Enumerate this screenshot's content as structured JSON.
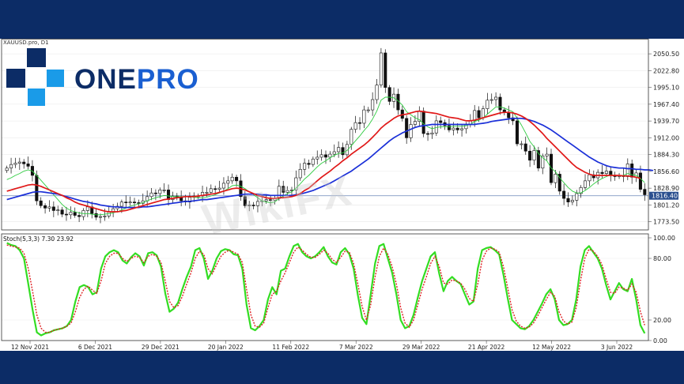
{
  "header": {
    "symbol": "XAUUSD.pro, D1"
  },
  "logo": {
    "prefix": "ONE",
    "suffix": "PRO"
  },
  "watermark": "WikiFX",
  "colors": {
    "background": "#0c2c66",
    "brand_dark": "#0c2c66",
    "brand_blue": "#1a5fd1",
    "ma_red": "#e01818",
    "ma_blue": "#1a2fd8",
    "ma_green": "#2ecc40",
    "stoch_main": "#33dd22",
    "stoch_signal": "#dd2222",
    "current_price_line": "#6c88b8"
  },
  "chart_data": [
    {
      "type": "candlestick",
      "title": "XAUUSD.pro, D1",
      "y_ticks": [
        "2050.50",
        "2022.80",
        "1995.10",
        "1967.40",
        "1939.70",
        "1912.00",
        "1884.30",
        "1856.60",
        "1828.90",
        "1801.20",
        "1773.50"
      ],
      "ylim": [
        1760,
        2065
      ],
      "current_price": 1816.4,
      "current_price_label": "1816.40",
      "x_ticks": [
        "12 Nov 2021",
        "6 Dec 2021",
        "29 Dec 2021",
        "20 Jan 2022",
        "11 Feb 2022",
        "7 Mar 2022",
        "29 Mar 2022",
        "21 Apr 2022",
        "12 May 2022",
        "3 Jun 2022"
      ],
      "close": [
        1862,
        1868,
        1870,
        1872,
        1869,
        1865,
        1850,
        1808,
        1800,
        1796,
        1798,
        1792,
        1793,
        1786,
        1785,
        1789,
        1784,
        1782,
        1792,
        1798,
        1787,
        1781,
        1782,
        1783,
        1790,
        1795,
        1799,
        1806,
        1805,
        1806,
        1805,
        1804,
        1808,
        1815,
        1821,
        1820,
        1826,
        1826,
        1810,
        1816,
        1813,
        1808,
        1806,
        1814,
        1816,
        1816,
        1822,
        1822,
        1828,
        1827,
        1829,
        1837,
        1841,
        1847,
        1841,
        1815,
        1800,
        1801,
        1800,
        1807,
        1808,
        1810,
        1809,
        1812,
        1832,
        1822,
        1825,
        1826,
        1846,
        1860,
        1870,
        1868,
        1877,
        1880,
        1884,
        1880,
        1885,
        1889,
        1896,
        1884,
        1901,
        1926,
        1937,
        1936,
        1958,
        1958,
        1975,
        1999,
        2052,
        1995,
        1972,
        1984,
        1958,
        1944,
        1912,
        1934,
        1939,
        1956,
        1919,
        1918,
        1920,
        1940,
        1937,
        1932,
        1925,
        1928,
        1925,
        1927,
        1934,
        1940,
        1957,
        1945,
        1960,
        1974,
        1975,
        1979,
        1958,
        1954,
        1945,
        1940,
        1902,
        1902,
        1890,
        1875,
        1891,
        1862,
        1882,
        1885,
        1838,
        1852,
        1824,
        1812,
        1806,
        1809,
        1820,
        1830,
        1841,
        1851,
        1846,
        1855,
        1853,
        1857,
        1850,
        1848,
        1850,
        1848,
        1869,
        1847,
        1854,
        1827,
        1818
      ],
      "sma_red": [
        1824,
        1826,
        1828,
        1830,
        1832,
        1834,
        1835,
        1834,
        1832,
        1829,
        1826,
        1823,
        1820,
        1817,
        1813,
        1810,
        1806,
        1803,
        1801,
        1799,
        1797,
        1795,
        1793,
        1791,
        1790,
        1790,
        1790,
        1791,
        1792,
        1794,
        1796,
        1798,
        1800,
        1802,
        1804,
        1806,
        1808,
        1810,
        1811,
        1812,
        1813,
        1814,
        1815,
        1815,
        1815,
        1816,
        1817,
        1818,
        1819,
        1820,
        1822,
        1824,
        1826,
        1828,
        1829,
        1828,
        1826,
        1823,
        1820,
        1817,
        1815,
        1813,
        1812,
        1812,
        1813,
        1813,
        1814,
        1815,
        1817,
        1820,
        1825,
        1829,
        1835,
        1841,
        1847,
        1852,
        1857,
        1863,
        1868,
        1874,
        1879,
        1885,
        1890,
        1895,
        1900,
        1906,
        1913,
        1920,
        1928,
        1934,
        1939,
        1944,
        1948,
        1950,
        1951,
        1953,
        1955,
        1956,
        1955,
        1954,
        1953,
        1952,
        1950,
        1948,
        1946,
        1945,
        1944,
        1942,
        1940,
        1940,
        1941,
        1943,
        1945,
        1947,
        1949,
        1951,
        1953,
        1954,
        1954,
        1953,
        1951,
        1948,
        1944,
        1939,
        1933,
        1926,
        1919,
        1911,
        1904,
        1897,
        1890,
        1883,
        1876,
        1869,
        1863,
        1859,
        1855,
        1852,
        1850,
        1850,
        1850,
        1850,
        1850,
        1850,
        1850,
        1849,
        1849,
        1848,
        1847,
        1845
      ],
      "sma_blue": [
        1810,
        1812,
        1814,
        1816,
        1818,
        1820,
        1822,
        1823,
        1823,
        1822,
        1821,
        1820,
        1819,
        1817,
        1815,
        1813,
        1811,
        1809,
        1807,
        1806,
        1804,
        1803,
        1801,
        1800,
        1799,
        1798,
        1798,
        1797,
        1797,
        1797,
        1797,
        1797,
        1798,
        1798,
        1799,
        1800,
        1801,
        1802,
        1803,
        1804,
        1805,
        1806,
        1807,
        1807,
        1808,
        1809,
        1810,
        1810,
        1811,
        1812,
        1813,
        1814,
        1815,
        1816,
        1817,
        1818,
        1819,
        1819,
        1819,
        1819,
        1818,
        1818,
        1817,
        1817,
        1817,
        1817,
        1817,
        1817,
        1818,
        1819,
        1821,
        1823,
        1825,
        1828,
        1831,
        1834,
        1837,
        1841,
        1845,
        1849,
        1853,
        1857,
        1862,
        1867,
        1872,
        1877,
        1883,
        1889,
        1895,
        1901,
        1907,
        1912,
        1916,
        1920,
        1923,
        1926,
        1929,
        1931,
        1932,
        1933,
        1934,
        1934,
        1934,
        1934,
        1934,
        1934,
        1934,
        1934,
        1934,
        1934,
        1934,
        1935,
        1936,
        1937,
        1939,
        1940,
        1941,
        1942,
        1943,
        1944,
        1944,
        1944,
        1943,
        1941,
        1939,
        1936,
        1933,
        1929,
        1925,
        1920,
        1915,
        1910,
        1905,
        1900,
        1895,
        1890,
        1885,
        1880,
        1876,
        1872,
        1869,
        1866,
        1864,
        1863,
        1862,
        1862,
        1861,
        1861,
        1860,
        1860,
        1859,
        1859,
        1858
      ],
      "sma_green": [
        1843,
        1846,
        1850,
        1853,
        1857,
        1859,
        1857,
        1850,
        1842,
        1834,
        1826,
        1818,
        1810,
        1802,
        1796,
        1792,
        1790,
        1788,
        1787,
        1787,
        1786,
        1785,
        1785,
        1786,
        1787,
        1788,
        1790,
        1793,
        1796,
        1799,
        1801,
        1803,
        1805,
        1808,
        1811,
        1813,
        1815,
        1817,
        1816,
        1815,
        1815,
        1815,
        1815,
        1815,
        1814,
        1813,
        1813,
        1814,
        1816,
        1818,
        1821,
        1824,
        1828,
        1833,
        1834,
        1832,
        1828,
        1823,
        1818,
        1813,
        1808,
        1806,
        1805,
        1806,
        1812,
        1816,
        1820,
        1823,
        1829,
        1836,
        1844,
        1850,
        1857,
        1864,
        1870,
        1874,
        1879,
        1883,
        1886,
        1887,
        1891,
        1899,
        1907,
        1915,
        1924,
        1932,
        1943,
        1956,
        1974,
        1979,
        1979,
        1978,
        1973,
        1966,
        1955,
        1950,
        1945,
        1942,
        1935,
        1930,
        1927,
        1929,
        1930,
        1930,
        1930,
        1931,
        1931,
        1931,
        1932,
        1934,
        1939,
        1941,
        1945,
        1951,
        1957,
        1963,
        1963,
        1961,
        1958,
        1955,
        1944,
        1933,
        1920,
        1906,
        1897,
        1886,
        1879,
        1874,
        1862,
        1856,
        1846,
        1838,
        1830,
        1824,
        1821,
        1821,
        1825,
        1830,
        1836,
        1841,
        1845,
        1848,
        1851,
        1850,
        1850,
        1850,
        1853,
        1851,
        1850,
        1845,
        1838
      ]
    },
    {
      "type": "line",
      "title": "Stoch(5,3,3) 7.30 23.92",
      "y_ticks": [
        "100.00",
        "80.00",
        "20.00",
        "0.00"
      ],
      "ylim": [
        0,
        100
      ],
      "series": [
        {
          "name": "Main",
          "values": [
            95,
            93,
            92,
            88,
            80,
            55,
            30,
            8,
            5,
            7,
            8,
            10,
            11,
            12,
            14,
            20,
            38,
            52,
            54,
            52,
            45,
            47,
            70,
            82,
            86,
            88,
            86,
            78,
            75,
            81,
            85,
            82,
            73,
            85,
            86,
            83,
            72,
            46,
            28,
            31,
            37,
            50,
            62,
            72,
            88,
            90,
            80,
            60,
            68,
            80,
            87,
            89,
            88,
            84,
            83,
            70,
            35,
            12,
            10,
            14,
            20,
            40,
            52,
            45,
            68,
            70,
            82,
            92,
            94,
            86,
            82,
            80,
            82,
            86,
            91,
            82,
            76,
            74,
            86,
            90,
            84,
            70,
            44,
            22,
            16,
            45,
            75,
            92,
            94,
            80,
            66,
            45,
            20,
            12,
            14,
            25,
            42,
            58,
            70,
            82,
            86,
            65,
            48,
            58,
            62,
            58,
            55,
            45,
            35,
            38,
            70,
            88,
            90,
            91,
            88,
            84,
            64,
            41,
            20,
            16,
            12,
            11,
            14,
            20,
            28,
            36,
            45,
            50,
            40,
            20,
            15,
            16,
            20,
            40,
            72,
            88,
            92,
            86,
            80,
            70,
            54,
            40,
            48,
            56,
            50,
            48,
            60,
            40,
            15,
            7
          ]
        },
        {
          "name": "Signal",
          "values": [
            93,
            92,
            91,
            90,
            85,
            70,
            48,
            25,
            12,
            8,
            8,
            10,
            11,
            12,
            14,
            17,
            28,
            42,
            50,
            53,
            49,
            46,
            58,
            75,
            82,
            85,
            85,
            80,
            77,
            80,
            82,
            81,
            76,
            82,
            84,
            82,
            76,
            58,
            38,
            32,
            34,
            43,
            55,
            66,
            80,
            87,
            84,
            70,
            65,
            74,
            82,
            86,
            88,
            86,
            84,
            76,
            50,
            25,
            14,
            13,
            17,
            32,
            45,
            48,
            58,
            66,
            76,
            86,
            91,
            88,
            84,
            81,
            81,
            84,
            88,
            85,
            79,
            76,
            81,
            87,
            86,
            75,
            55,
            33,
            20,
            35,
            62,
            82,
            90,
            84,
            72,
            55,
            32,
            17,
            13,
            20,
            35,
            50,
            62,
            75,
            82,
            72,
            56,
            55,
            59,
            58,
            56,
            50,
            41,
            38,
            55,
            78,
            87,
            90,
            89,
            86,
            72,
            51,
            30,
            19,
            14,
            12,
            13,
            17,
            24,
            32,
            40,
            47,
            43,
            28,
            19,
            16,
            18,
            32,
            58,
            80,
            89,
            87,
            82,
            74,
            60,
            47,
            46,
            52,
            51,
            49,
            55,
            47,
            28,
            15
          ]
        }
      ]
    }
  ]
}
